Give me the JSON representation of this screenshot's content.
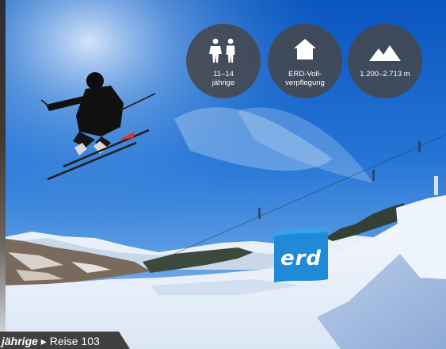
{
  "badges": {
    "age": {
      "icon": "children-icon",
      "line1": "11–14",
      "line2": "jährige"
    },
    "food": {
      "icon": "house-icon",
      "line1": "ERD-Voll-",
      "line2": "verpflegung"
    },
    "altitude": {
      "icon": "mountain-icon",
      "label": "1.200–2.713 m"
    }
  },
  "banner": {
    "logo_text": "erd"
  },
  "footer": {
    "age_label": "jährige",
    "arrow": "▸",
    "trip_label": "Reise 103"
  },
  "colors": {
    "sky": "#1a64c8",
    "badge_bg": "#464648",
    "banner": "#1f8ad8",
    "footer_bg": "#404040",
    "snow": "#ffffff"
  }
}
